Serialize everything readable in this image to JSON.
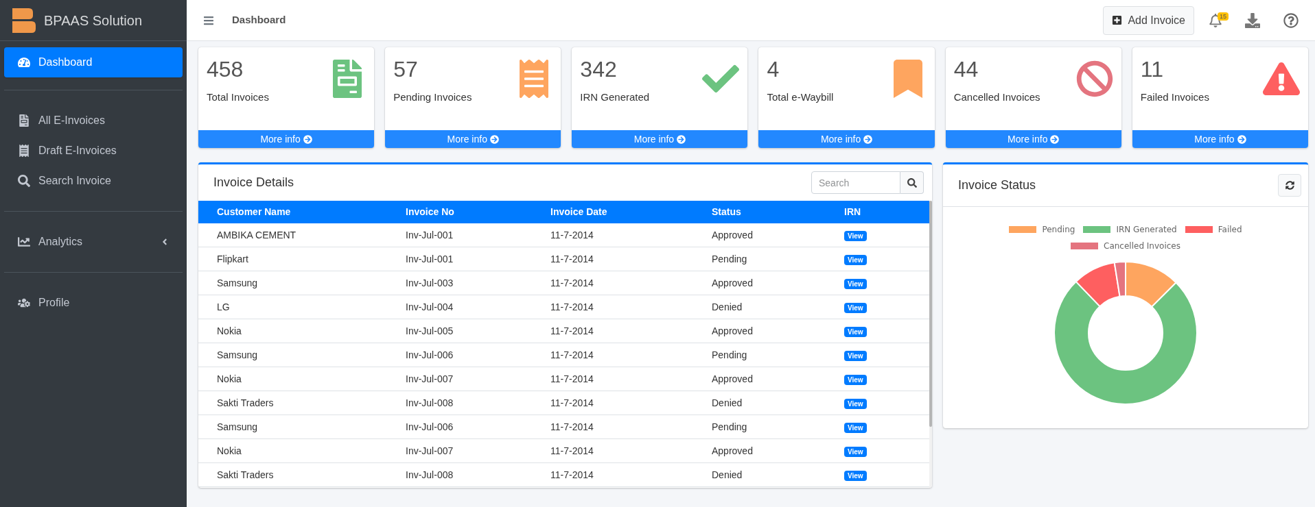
{
  "brand": {
    "name": "BPAAS Solution"
  },
  "sidebar": {
    "groups": [
      [
        {
          "label": "Dashboard",
          "selected": true,
          "kind": "link"
        }
      ],
      [
        {
          "label": "All E-Invoices",
          "selected": false,
          "kind": "link"
        },
        {
          "label": "Draft E-Invoices",
          "selected": false,
          "kind": "link"
        },
        {
          "label": "Search Invoice",
          "selected": false,
          "kind": "link"
        }
      ],
      [
        {
          "label": "Analytics",
          "selected": false,
          "kind": "submenu"
        }
      ],
      [
        {
          "label": "Profile",
          "selected": false,
          "kind": "link"
        }
      ]
    ]
  },
  "header": {
    "title": "Dashboard",
    "add_button": "Add Invoice",
    "notification_count": "15"
  },
  "cards": [
    {
      "value": "458",
      "label": "Total Invoices",
      "link": "More info"
    },
    {
      "value": "57",
      "label": "Pending Invoices",
      "link": "More info"
    },
    {
      "value": "342",
      "label": "IRN Generated",
      "link": "More info"
    },
    {
      "value": "4",
      "label": "Total e-Waybill",
      "link": "More info"
    },
    {
      "value": "44",
      "label": "Cancelled Invoices",
      "link": "More info"
    },
    {
      "value": "11",
      "label": "Failed Invoices",
      "link": "More info"
    }
  ],
  "invoice_details": {
    "title": "Invoice Details",
    "search": {
      "placeholder": "Search"
    },
    "columns": [
      "Customer Name",
      "Invoice No",
      "Invoice Date",
      "Status",
      "IRN"
    ],
    "rows": [
      [
        "AMBIKA CEMENT",
        "Inv-Jul-001",
        "11-7-2014",
        "Approved",
        "View"
      ],
      [
        "Flipkart",
        "Inv-Jul-001",
        "11-7-2014",
        "Pending",
        "View"
      ],
      [
        "Samsung",
        "Inv-Jul-003",
        "11-7-2014",
        "Approved",
        "View"
      ],
      [
        "LG",
        "Inv-Jul-004",
        "11-7-2014",
        "Denied",
        "View"
      ],
      [
        "Nokia",
        "Inv-Jul-005",
        "11-7-2014",
        "Approved",
        "View"
      ],
      [
        "Samsung",
        "Inv-Jul-006",
        "11-7-2014",
        "Pending",
        "View"
      ],
      [
        "Nokia",
        "Inv-Jul-007",
        "11-7-2014",
        "Approved",
        "View"
      ],
      [
        "Sakti Traders",
        "Inv-Jul-008",
        "11-7-2014",
        "Denied",
        "View"
      ],
      [
        "Samsung",
        "Inv-Jul-006",
        "11-7-2014",
        "Pending",
        "View"
      ],
      [
        "Nokia",
        "Inv-Jul-007",
        "11-7-2014",
        "Approved",
        "View"
      ],
      [
        "Sakti Traders",
        "Inv-Jul-008",
        "11-7-2014",
        "Denied",
        "View"
      ]
    ]
  },
  "invoice_status": {
    "title": "Invoice Status",
    "legend": [
      {
        "label": "Pending",
        "color": "#fea55f"
      },
      {
        "label": "IRN Generated",
        "color": "#6cc380"
      },
      {
        "label": "Failed",
        "color": "#fe5f60"
      },
      {
        "label": "Cancelled Invoices",
        "color": "#e4747f"
      }
    ]
  }
}
